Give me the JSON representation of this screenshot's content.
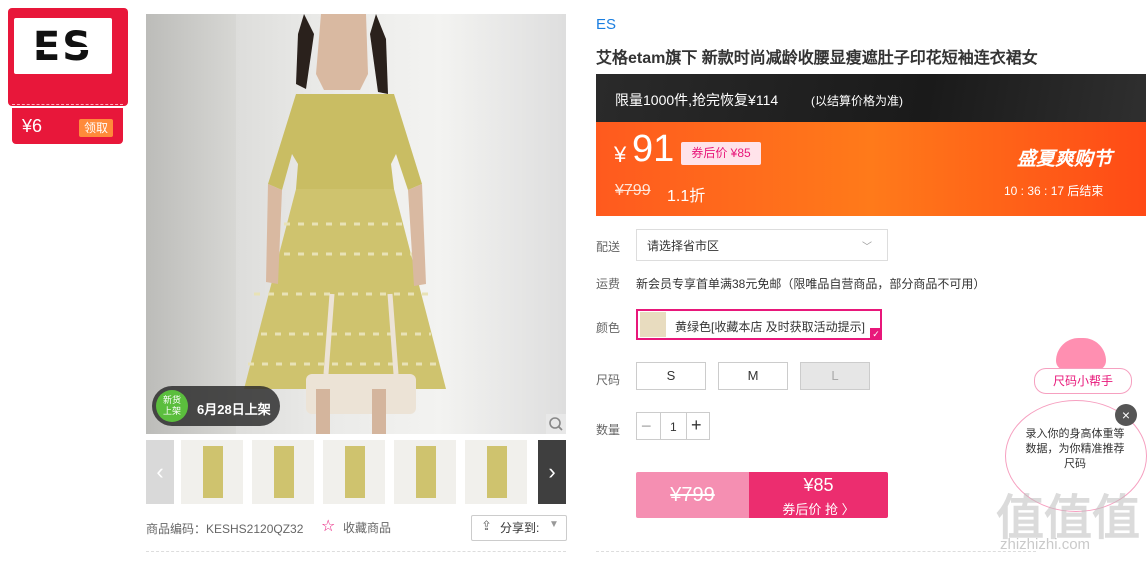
{
  "brand_badge": {
    "logo": "ES",
    "coupon_amount": "¥6",
    "coupon_button": "领取"
  },
  "gallery": {
    "new_tag_top": "新货",
    "new_tag_bottom": "上架",
    "new_date": "6月28日上架",
    "prev_icon": "chevron-left-icon",
    "next_icon": "chevron-right-icon",
    "zoom_icon": "zoom-icon"
  },
  "meta": {
    "product_code": "商品编码：KESHS2120QZ32",
    "favorite_label": "收藏商品",
    "share_label": "分享到:"
  },
  "product": {
    "brand": "ES",
    "title": "艾格etam旗下 新款时尚减龄收腰显瘦遮肚子印花短袖连衣裙女"
  },
  "promo": {
    "limit_text": "限量1000件,抢完恢复¥114",
    "limit_note": "(以结算价格为准)",
    "currency": "¥",
    "price": "91",
    "after_coupon": "券后价 ¥85",
    "original_price": "¥799",
    "discount": "1.1折",
    "festival": "盛夏爽购节",
    "countdown": "10 : 36 : 17  后结束"
  },
  "options": {
    "delivery_label": "配送",
    "delivery_value": "请选择省市区",
    "shipping_label": "运费",
    "shipping_text": "新会员专享首单满38元免邮（限唯品自营商品，部分商品不可用）",
    "color_label": "颜色",
    "color_value": "黄绿色[收藏本店 及时获取活动提示]",
    "size_label": "尺码",
    "sizes": [
      "S",
      "M",
      "L"
    ],
    "qty_label": "数量",
    "qty_minus": "−",
    "qty_value": "1",
    "qty_plus": "+"
  },
  "buy": {
    "original": "¥799",
    "price": "¥85",
    "label": "券后价 抢 〉"
  },
  "size_helper": {
    "title": "尺码小帮手",
    "text": "录入你的身高体重等数据，为你精准推荐尺码",
    "close": "×"
  },
  "watermark": {
    "text": "值值值",
    "url": "zhizhizhi.com"
  },
  "colors": {
    "accent_pink": "#e8177a",
    "promo_orange": "#ff5a1e",
    "brand_red": "#e8173a",
    "link_blue": "#1a7ee0"
  }
}
